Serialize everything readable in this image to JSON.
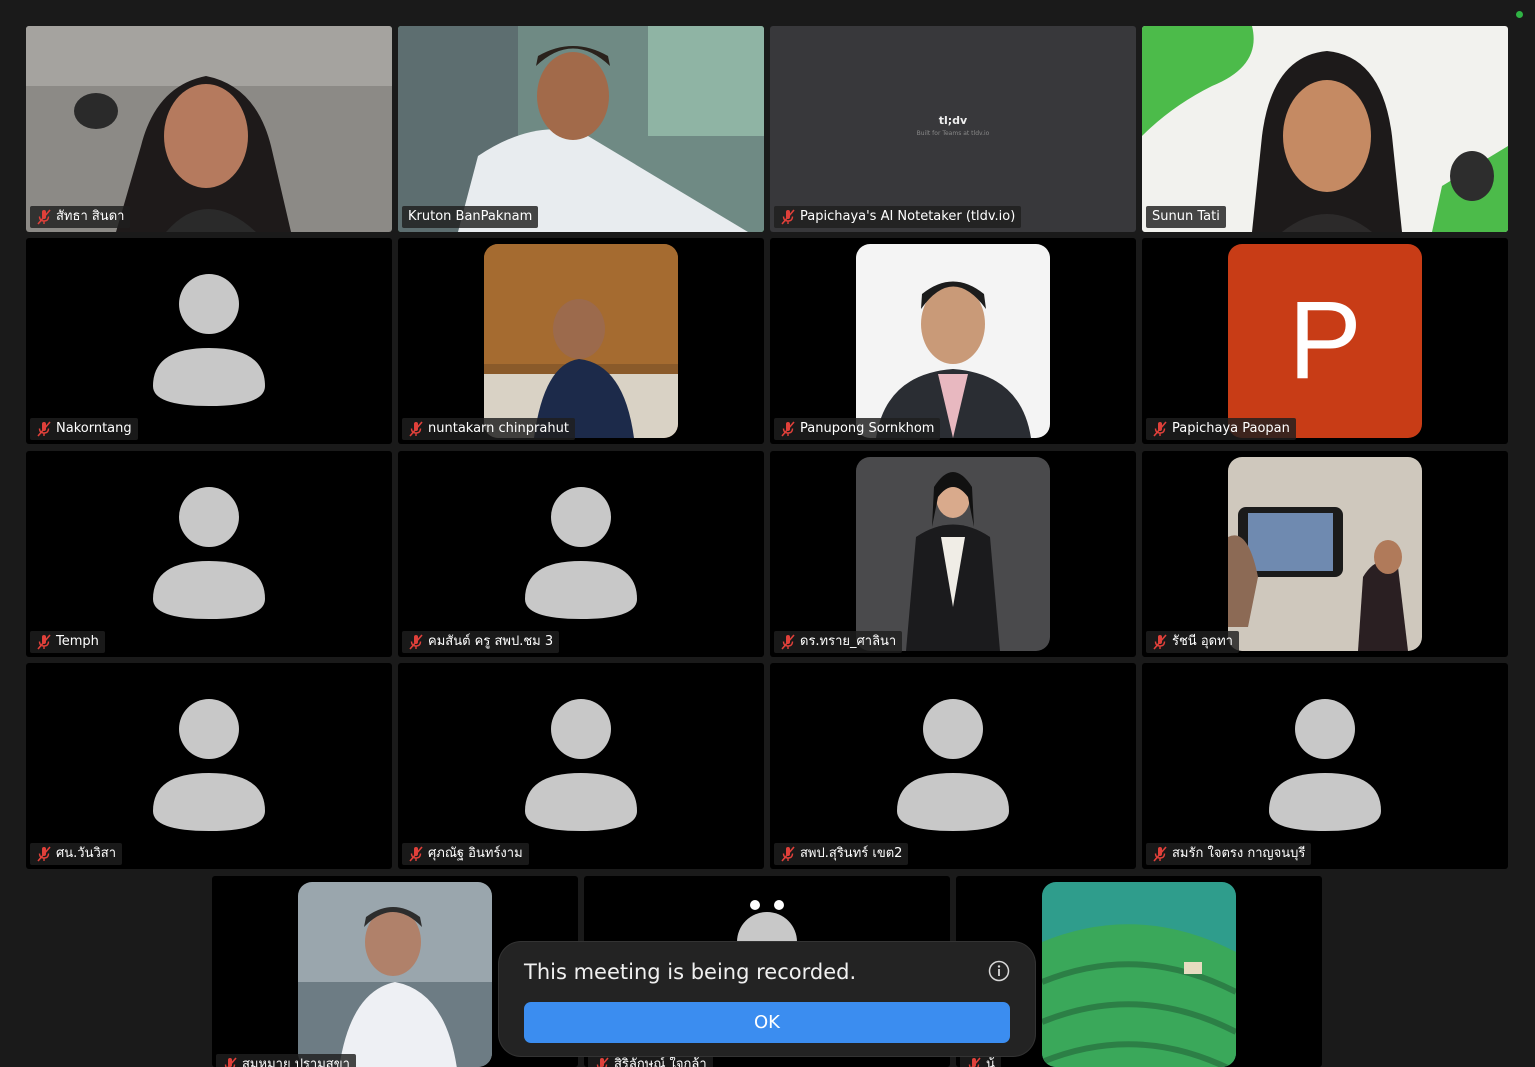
{
  "participants": [
    {
      "name": "สัทธา สินดา",
      "muted": true,
      "video": "camera"
    },
    {
      "name": "Kruton BanPaknam",
      "muted": false,
      "video": "camera",
      "speaking": true
    },
    {
      "name": "Papichaya's AI Notetaker (tldv.io)",
      "muted": true,
      "video": "screen"
    },
    {
      "name": "Sunun Tati",
      "muted": false,
      "video": "camera"
    },
    {
      "name": "Nakorntang",
      "muted": true,
      "video": "off"
    },
    {
      "name": "nuntakarn chinprahut",
      "muted": true,
      "video": "photo"
    },
    {
      "name": "Panupong Sornkhom",
      "muted": true,
      "video": "photo"
    },
    {
      "name": "Papichaya Paopan",
      "muted": true,
      "video": "letter",
      "initial": "P"
    },
    {
      "name": "Temph",
      "muted": true,
      "video": "off"
    },
    {
      "name": "คมสันต์ ครู สพป.ชม 3",
      "muted": true,
      "video": "off"
    },
    {
      "name": "ดร.ทราย_ศาลินา",
      "muted": true,
      "video": "photo"
    },
    {
      "name": "รัชนี อุดทา",
      "muted": true,
      "video": "photo"
    },
    {
      "name": "ศน.วันวิสา",
      "muted": true,
      "video": "off"
    },
    {
      "name": "ศุภณัฐ อินทร์งาม",
      "muted": true,
      "video": "off"
    },
    {
      "name": "สพป.สุรินทร์ เขต2",
      "muted": true,
      "video": "off"
    },
    {
      "name": "สมรัก ใจตรง กาญจนบุรี",
      "muted": true,
      "video": "off"
    },
    {
      "name": "สมหมาย ปรามสุขา",
      "muted": true,
      "video": "photo"
    },
    {
      "name": "สิริลักษณ์ ใจกล้า",
      "muted": true,
      "video": "off"
    },
    {
      "name": "น้",
      "muted": true,
      "video": "photo"
    }
  ],
  "notetaker_screen": {
    "brand": "tl;dv",
    "sub": "Built for Teams at tldv.io"
  },
  "recording_dialog": {
    "message": "This meeting is being recorded.",
    "ok_label": "OK"
  },
  "colors": {
    "accent": "#3b8df0",
    "active_speaker": "#2ecc58",
    "mute": "#e0403a",
    "letter_avatar": "#c83c16"
  }
}
